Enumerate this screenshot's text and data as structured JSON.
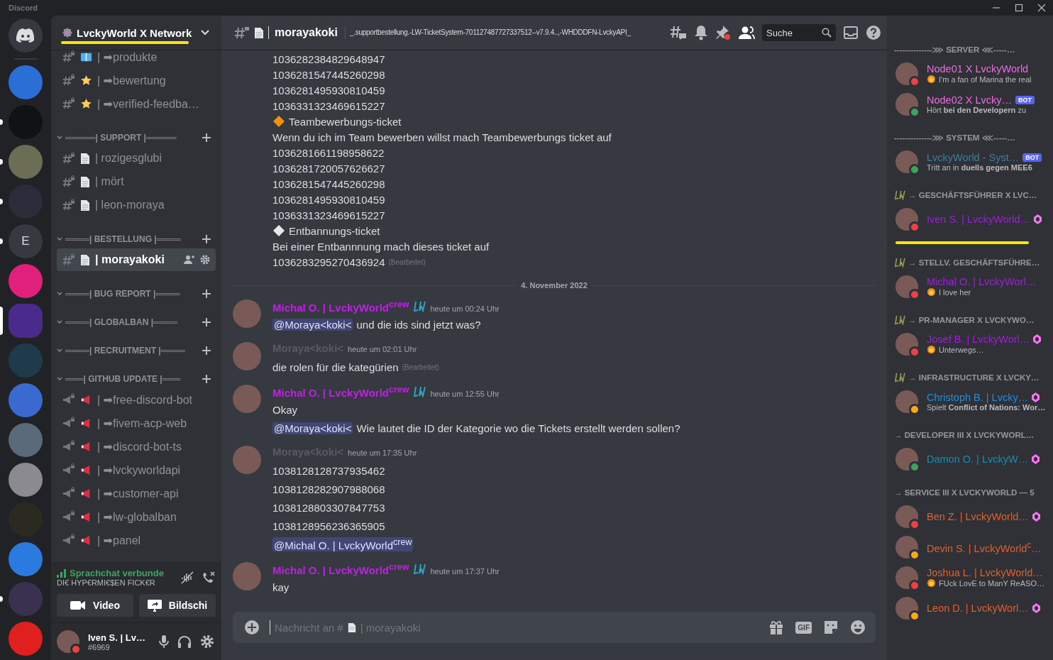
{
  "app_title": "Discord",
  "servers": [
    {
      "color": "#2b6fd6",
      "selected": false,
      "unread": false
    },
    {
      "color": "#111214",
      "selected": false,
      "unread": true
    },
    {
      "color": "#6b6e55",
      "selected": false,
      "unread": true
    },
    {
      "color": "#2a2c3a",
      "selected": false,
      "unread": true
    },
    {
      "letter": "E",
      "color": "#36393f",
      "selected": false,
      "unread": true
    },
    {
      "color": "#e0207a",
      "selected": false,
      "unread": false
    },
    {
      "color": "#4a2a8a",
      "selected": true,
      "unread": false
    },
    {
      "color": "#1f3a4a",
      "selected": false,
      "unread": false
    },
    {
      "color": "#3a6ad0",
      "selected": false,
      "unread": false
    },
    {
      "color": "#5a6a7a",
      "selected": false,
      "unread": false
    },
    {
      "color": "#8a8a90",
      "selected": false,
      "unread": false
    },
    {
      "color": "#2a2a20",
      "selected": false,
      "unread": false
    },
    {
      "color": "#2a7ae0",
      "selected": false,
      "unread": false
    },
    {
      "color": "#3a3050",
      "selected": false,
      "unread": true
    },
    {
      "color": "#e01f1f",
      "selected": false,
      "unread": false
    }
  ],
  "server_name": "LvckyWorld X Network",
  "channels": [
    {
      "kind": "book",
      "name": "| ➡produkte",
      "selected": false
    },
    {
      "kind": "star",
      "name": "| ➡bewertung",
      "selected": false
    },
    {
      "kind": "star",
      "name": "| ➡verified-feedba…",
      "selected": false
    },
    {
      "kind": "category",
      "name": "═════| SUPPORT |═════"
    },
    {
      "kind": "ticket",
      "name": "| rozigesglubi",
      "selected": false
    },
    {
      "kind": "ticket",
      "name": "| mört",
      "selected": false
    },
    {
      "kind": "ticket",
      "name": "| leon-moraya",
      "selected": false
    },
    {
      "kind": "category",
      "name": "════| BESTELLUNG |════"
    },
    {
      "kind": "ticket",
      "name": "| morayakoki",
      "selected": true
    },
    {
      "kind": "category",
      "name": "════| BUG REPORT |════"
    },
    {
      "kind": "category",
      "name": "════| GLOBALBAN |════"
    },
    {
      "kind": "category",
      "name": "════| RECRUITMENT |════"
    },
    {
      "kind": "category",
      "name": "═══| GITHUB UPDATE |═══"
    },
    {
      "kind": "announcement",
      "name": "| ➡free-discord-bot",
      "selected": false
    },
    {
      "kind": "announcement",
      "name": "| ➡fivem-acp-web",
      "selected": false
    },
    {
      "kind": "announcement",
      "name": "| ➡discord-bot-ts",
      "selected": false
    },
    {
      "kind": "announcement",
      "name": "| ➡lvckyworldapi",
      "selected": false
    },
    {
      "kind": "announcement",
      "name": "| ➡customer-api",
      "selected": false
    },
    {
      "kind": "announcement",
      "name": "| ➡lw-globalban",
      "selected": false
    },
    {
      "kind": "announcement",
      "name": "| ➡panel",
      "selected": false
    }
  ],
  "voice": {
    "status": "Sprachchat verbunde",
    "channel": "DI€ HYP€RMI€$EN FICK€R",
    "buttons": [
      "Video",
      "Bildschi"
    ]
  },
  "user": {
    "name": "Iven S. | Lv…",
    "tag": "#6969",
    "kind": "dnd"
  },
  "header": {
    "channel": "morayakoki",
    "topic": "_.supportbestellung.-LW-TicketSystem-701127487727337512--v7.9.4..,-WHDDDFN-LvckyAPI_",
    "search_placeholder": "Suche"
  },
  "top_lines": [
    {
      "kind": "text",
      "text": "1036282384829648947"
    },
    {
      "kind": "text",
      "text": "1036281547445260298"
    },
    {
      "kind": "text",
      "text": "1036281495930810459"
    },
    {
      "kind": "text",
      "text": "1036331323469615227"
    },
    {
      "kind": "ticket",
      "color": "#f4900c",
      "text": "Teambewerbungs-ticket"
    },
    {
      "kind": "text",
      "text": "Wenn du ich im Team bewerben willst mach Teambewerbungs ticket auf"
    },
    {
      "kind": "text",
      "text": "1036281661198958622"
    },
    {
      "kind": "text",
      "text": "1036281720057626627"
    },
    {
      "kind": "text",
      "text": "1036281547445260298"
    },
    {
      "kind": "text",
      "text": "1036281495930810459"
    },
    {
      "kind": "text",
      "text": "1036331323469615227"
    },
    {
      "kind": "ticket",
      "color": "#e6e7e8",
      "text": "Entbannungs-ticket"
    },
    {
      "kind": "text",
      "text": "Bei einer Entbannnung mach dieses ticket auf"
    },
    {
      "kind": "text",
      "text": "1036283295270436924",
      "edited": "(Bearbeitet)"
    }
  ],
  "date_divider": "4. November 2022",
  "messages": [
    {
      "author": "Michal O. | LvckyWorld$^{crew}$",
      "color": "#c11fe8",
      "role_icon": true,
      "time": "heute um 00:24 Uhr",
      "lines": [
        {
          "mention": "@Moraya<koki<",
          "text": "und die ids sind jetzt was?"
        }
      ]
    },
    {
      "author": "Moraya<koki<",
      "color": "#585b63",
      "role_icon": false,
      "time": "heute um 02:01 Uhr",
      "lines": [
        {
          "text": "die rolen für die kategürien",
          "edited": "(Bearbeitet)"
        }
      ]
    },
    {
      "author": "Michal O. | LvckyWorld$^{crew}$",
      "color": "#c11fe8",
      "role_icon": true,
      "time": "heute um 12:55 Uhr",
      "lines": [
        {
          "text": "Okay"
        },
        {
          "mention": "@Moraya<koki<",
          "text": "Wie lautet die ID der Kategorie wo die Tickets erstellt werden sollen?"
        }
      ]
    },
    {
      "author": "Moraya<koki<",
      "color": "#585b63",
      "role_icon": false,
      "time": "heute um 17:35 Uhr",
      "lines": [
        {
          "text": "1038128128737935462"
        },
        {
          "text": "1038128282907988068"
        },
        {
          "text": "1038128803307847753"
        },
        {
          "text": "1038128956236365905"
        },
        {
          "mention": "@Michal O. | LvckyWorld$^{crew}$"
        }
      ]
    },
    {
      "author": "Michal O. | LvckyWorld$^{crew}$",
      "color": "#c11fe8",
      "role_icon": true,
      "time": "heute um 17:37 Uhr",
      "lines": [
        {
          "text": "kay"
        }
      ]
    }
  ],
  "composer": {
    "placeholder": "Nachricht an #",
    "placeholder_channel": "| morayakoki",
    "gif": "GIF"
  },
  "member_groups": [
    {
      "title": "--------------⋙ SERVER ⋘-----…",
      "lw_icon": false,
      "members": [
        {
          "name": "Node01 X LvckyWorld",
          "color": "#f06ae0",
          "kind": "dnd",
          "activity": "I'm a fan of Marina the real",
          "activity_emoji": true
        },
        {
          "name": "Node02 X Lvcky…",
          "color": "#f06ae0",
          "kind": "online",
          "bot": "BOT",
          "activity": "Hört **bei den Developern** zu"
        }
      ]
    },
    {
      "title": "--------------⋙ SYSTEM ⋘-----…",
      "lw_icon": false,
      "members": [
        {
          "name": "LvckyWorld - Syst…",
          "color": "#3d7f9c",
          "kind": "online",
          "bot": "BOT",
          "activity": "Tritt an in **duells gegen MEE6**"
        }
      ]
    },
    {
      "title": "→ GESCHÄFTSFÜHRER X LVC…",
      "lw_icon": true,
      "members": [
        {
          "name": "Iven S. | LvckyWorld…",
          "color": "#a21ce0",
          "kind": "dnd",
          "boost": true
        }
      ]
    },
    {
      "title": "→ STELLV. GESCHÄFTSFÜHRE…",
      "lw_icon": true,
      "members": [
        {
          "name": "Michal O. | LvckyWorl…",
          "color": "#a21ce0",
          "kind": "dnd",
          "activity": "I love her",
          "activity_emoji": true
        }
      ]
    },
    {
      "title": "→ PR-MANAGER X LVCKYWO…",
      "lw_icon": true,
      "members": [
        {
          "name": "Josef B. | LvckyWorl…",
          "color": "#a21ce0",
          "kind": "dnd",
          "boost": true,
          "activity": "Unterwegs…",
          "activity_emoji": true
        }
      ]
    },
    {
      "title": "→ INFRASTRUCTURE X LVCKY…",
      "lw_icon": true,
      "members": [
        {
          "name": "Christoph B. | Lvcky…",
          "color": "#1a8fe6",
          "kind": "idle",
          "boost": true,
          "activity": "Spielt **Conflict of Nations: Wor…**"
        }
      ]
    },
    {
      "title": "→ DEVELOPER III X LVCKYWORL…",
      "lw_icon": false,
      "members": [
        {
          "name": "Damon O. | LvckyW…",
          "color": "#1b8db0",
          "kind": "online",
          "boost": true
        }
      ]
    },
    {
      "title": "→ SERVICE III X LVCKYWORLD — 5",
      "lw_icon": false,
      "members": [
        {
          "name": "Ben Z. | LvckyWorld…",
          "color": "#e0602a",
          "kind": "dnd",
          "boost": true
        },
        {
          "name": "Devin S. | LvckyWorld$^{c}$…",
          "color": "#e0602a",
          "kind": "idle"
        },
        {
          "name": "Joshua L. | LvckyWorld…",
          "color": "#e0602a",
          "kind": "dnd",
          "activity": "FUck LovE to ManY ReASO…",
          "activity_emoji": true
        },
        {
          "name": "Leon D. | LvckyWorl…",
          "color": "#e0602a",
          "kind": "idle",
          "boost": true
        }
      ]
    }
  ]
}
